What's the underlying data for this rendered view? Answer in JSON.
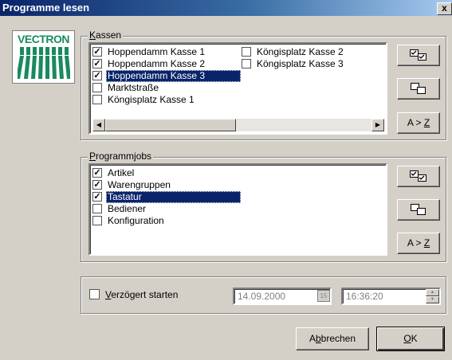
{
  "window": {
    "title": "Programme lesen",
    "close_glyph": "x"
  },
  "logo": {
    "text": "VECTRON",
    "color": "#1a8a5e"
  },
  "kassen": {
    "legend_prefix": "",
    "legend_underline": "K",
    "legend_rest": "assen",
    "items": [
      {
        "label": "Hoppendamm Kasse 1",
        "checked": true,
        "selected": false
      },
      {
        "label": "Hoppendamm Kasse 2",
        "checked": true,
        "selected": false
      },
      {
        "label": "Hoppendamm Kasse 3",
        "checked": true,
        "selected": true
      },
      {
        "label": "Marktstraße",
        "checked": false,
        "selected": false
      },
      {
        "label": "Köngisplatz Kasse 1",
        "checked": false,
        "selected": false
      },
      {
        "label": "Köngisplatz Kasse 2",
        "checked": false,
        "selected": false
      },
      {
        "label": "Köngisplatz Kasse 3",
        "checked": false,
        "selected": false
      }
    ],
    "sort_label": "A > Z",
    "sort_label_prefix": "A > ",
    "sort_label_underline": "Z"
  },
  "programmjobs": {
    "legend_underline": "P",
    "legend_rest": "rogrammjobs",
    "items": [
      {
        "label": "Artikel",
        "checked": true,
        "selected": false
      },
      {
        "label": "Warengruppen",
        "checked": true,
        "selected": false
      },
      {
        "label": "Tastatur",
        "checked": true,
        "selected": true
      },
      {
        "label": "Bediener",
        "checked": false,
        "selected": false
      },
      {
        "label": "Konfiguration",
        "checked": false,
        "selected": false
      }
    ],
    "sort_label_prefix": "A > ",
    "sort_label_underline": "Z"
  },
  "delay": {
    "checkbox_label_underline": "V",
    "checkbox_label_rest": "erzögert starten",
    "checked": false,
    "date_value": "14.09.2000",
    "calendar_glyph": "15",
    "time_value": "16:36:20"
  },
  "buttons": {
    "cancel_prefix": "A",
    "cancel_underline": "b",
    "cancel_rest": "brechen",
    "ok_underline": "O",
    "ok_rest": "K"
  }
}
